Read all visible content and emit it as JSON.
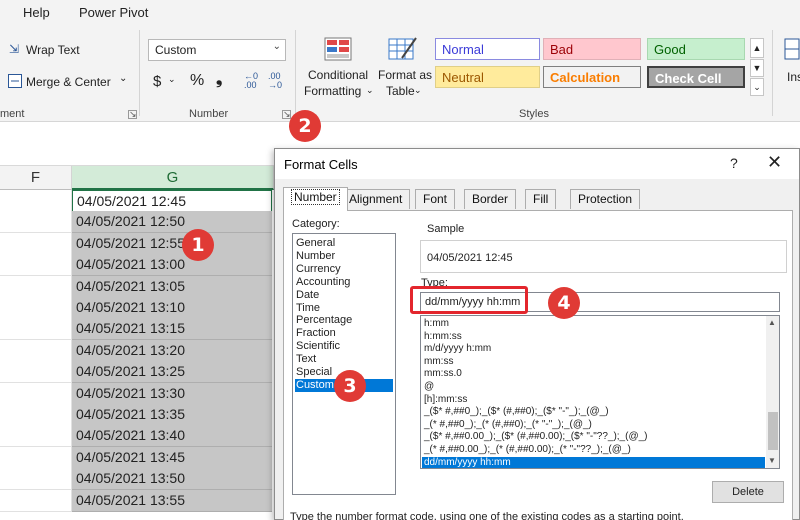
{
  "ribbon": {
    "tabs": [
      "Help",
      "Power Pivot"
    ],
    "wrap_text": "Wrap Text",
    "merge_center": "Merge & Center",
    "alignment_group": "ment",
    "number_format": "Custom",
    "number_group": "Number",
    "conditional_formatting": [
      "Conditional",
      "Formatting"
    ],
    "format_as_table": [
      "Format as",
      "Table"
    ],
    "styles_group": "Styles",
    "styles": [
      {
        "label": "Normal",
        "bg": "#ffffff",
        "color": "#3b3bd8",
        "border": "#8a8ae0"
      },
      {
        "label": "Bad",
        "bg": "#ffc7ce",
        "color": "#9c0006",
        "border": "#e0b0b7"
      },
      {
        "label": "Good",
        "bg": "#c6efce",
        "color": "#006100",
        "border": "#a8d8b0"
      },
      {
        "label": "Neutral",
        "bg": "#ffeb9c",
        "color": "#9c5700",
        "border": "#e0cf88"
      },
      {
        "label": "Calculation",
        "bg": "#f2f2f2",
        "color": "#fa7d00",
        "border": "#7f7f7f"
      },
      {
        "label": "Check Cell",
        "bg": "#a5a5a5",
        "color": "#ffffff",
        "border": "#3f3f3f"
      }
    ],
    "insert_partial": "Ins"
  },
  "sheet": {
    "col_f": "F",
    "col_g": "G",
    "cells": [
      "04/05/2021 12:45",
      "04/05/2021 12:50",
      "04/05/2021 12:55",
      "04/05/2021 13:00",
      "04/05/2021 13:05",
      "04/05/2021 13:10",
      "04/05/2021 13:15",
      "04/05/2021 13:20",
      "04/05/2021 13:25",
      "04/05/2021 13:30",
      "04/05/2021 13:35",
      "04/05/2021 13:40",
      "04/05/2021 13:45",
      "04/05/2021 13:50",
      "04/05/2021 13:55"
    ]
  },
  "dialog": {
    "title": "Format Cells",
    "help": "?",
    "close": "✕",
    "tabs": [
      "Number",
      "Alignment",
      "Font",
      "Border",
      "Fill",
      "Protection"
    ],
    "category_label": "Category:",
    "categories": [
      "General",
      "Number",
      "Currency",
      "Accounting",
      "Date",
      "Time",
      "Percentage",
      "Fraction",
      "Scientific",
      "Text",
      "Special",
      "Custom"
    ],
    "selected_category": "Custom",
    "sample_label": "Sample",
    "sample_value": "04/05/2021 12:45",
    "type_label": "Type:",
    "type_value": "dd/mm/yyyy hh:mm",
    "formats": [
      "h:mm",
      "h:mm:ss",
      "m/d/yyyy h:mm",
      "mm:ss",
      "mm:ss.0",
      "@",
      "[h]:mm:ss",
      "_($* #,##0_);_($* (#,##0);_($* \"-\"_);_(@_)",
      "_(* #,##0_);_(* (#,##0);_(* \"-\"_);_(@_)",
      "_($* #,##0.00_);_($* (#,##0.00);_($* \"-\"??_);_(@_)",
      "_(* #,##0.00_);_(* (#,##0.00);_(* \"-\"??_);_(@_)",
      "dd/mm/yyyy hh:mm"
    ],
    "delete_label": "Delete",
    "help_text": "Type the number format code, using one of the existing codes as a starting point."
  },
  "callouts": [
    "1",
    "2",
    "3",
    "4"
  ],
  "colors": {
    "accent": "#217346",
    "selection": "#0078d7",
    "callout": "#e03a35"
  }
}
